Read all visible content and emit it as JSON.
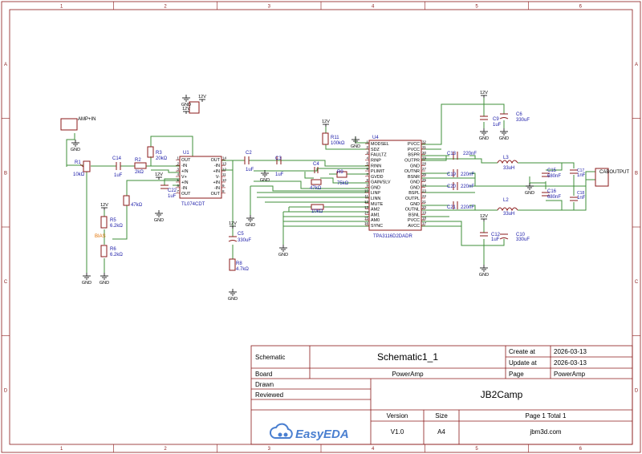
{
  "colors": {
    "frame": "#8b1a1a",
    "wire": "#3f8f3a",
    "part": "#8b1a1a",
    "label": "#1a1aa8",
    "pin": "#000000",
    "bias": "#e07000",
    "logo": "#4a7fd0"
  },
  "frame": {
    "columns": [
      "1",
      "2",
      "3",
      "4",
      "5",
      "6"
    ],
    "rows": [
      "A",
      "B",
      "C",
      "D"
    ]
  },
  "title_block": {
    "schematic_label": "Schematic",
    "schematic_value": "Schematic1_1",
    "create_label": "Create at",
    "create_value": "2026-03-13",
    "update_label": "Update at",
    "update_value": "2026-03-13",
    "board_label": "Board",
    "board_value": "PowerAmp",
    "page_label": "Page",
    "page_value": "PowerAmp",
    "drawn_label": "Drawn",
    "reviewed_label": "Reviewed",
    "company": "JB2Camp",
    "version_label": "Version",
    "version_value": "V1.0",
    "size_label": "Size",
    "size_value": "A4",
    "page_count": "Page  1  Total  1",
    "website": "jbm3d.com",
    "logo_text": "EasyEDA"
  },
  "labels": {
    "gnd": "GND",
    "v12": "12V",
    "amp_in": "AMP+IN",
    "bias": "BIAS",
    "cab_output": "CABOUTPUT",
    "r1": "R1",
    "r1_val": "10kΩ",
    "r2": "R2",
    "r2_val": "2kΩ",
    "r3": "R3",
    "r3_val": "20kΩ",
    "r4_val": "47kΩ",
    "r5": "R5",
    "r5_val": "6.2kΩ",
    "r6": "R6",
    "r6_val": "6.2kΩ",
    "r7_val": "47kΩ",
    "r8": "R8",
    "r8_val": "4.7kΩ",
    "r9": "R9",
    "r9_val": "75kΩ",
    "r10_val": "10kΩ",
    "r11": "R11",
    "r11_val": "100kΩ",
    "c1uf": "1uF",
    "c2": "C2",
    "c3": "C3",
    "c4": "C4",
    "c5": "C5",
    "c9": "C9",
    "c10": "C10",
    "c12": "C12",
    "c13": "C13",
    "c14": "C14",
    "c15": "C15",
    "c16": "C16",
    "c17": "C17",
    "c18": "C18",
    "c19": "C19",
    "c20": "C20",
    "c21": "C21",
    "c22": "C22",
    "c6": "C6",
    "c5_val": "330uF",
    "c6_val": "330uF",
    "c10_val": "330uF",
    "c15_val": "680nF",
    "c16_val": "680nF",
    "c220": "220nF",
    "c17_val": "1nF",
    "c18_val": "1nF",
    "l2": "L2",
    "l3": "L3",
    "l_val": "33uH",
    "u1": "U1",
    "u1_part": "TL074CDT",
    "u4": "U4",
    "u4_part": "TPA3116D2DADR"
  },
  "u1_pins_left": [
    {
      "num": "1",
      "name": "OUT"
    },
    {
      "num": "2",
      "name": "-IN"
    },
    {
      "num": "3",
      "name": "+IN"
    },
    {
      "num": "4",
      "name": "V+"
    },
    {
      "num": "5",
      "name": "+IN"
    },
    {
      "num": "6",
      "name": "-IN"
    },
    {
      "num": "7",
      "name": "OUT"
    }
  ],
  "u1_pins_right": [
    {
      "num": "14",
      "name": "OUT"
    },
    {
      "num": "13",
      "name": "-IN"
    },
    {
      "num": "12",
      "name": "+IN"
    },
    {
      "num": "11",
      "name": "V-"
    },
    {
      "num": "10",
      "name": "+IN"
    },
    {
      "num": "9",
      "name": "-IN"
    },
    {
      "num": "8",
      "name": "OUT"
    }
  ],
  "u4_pins_left": [
    {
      "num": "1",
      "name": "MODSEL"
    },
    {
      "num": "2",
      "name": "SDZ"
    },
    {
      "num": "3",
      "name": "FAULTZ"
    },
    {
      "num": "4",
      "name": "RINP"
    },
    {
      "num": "5",
      "name": "RINN"
    },
    {
      "num": "6",
      "name": "PLIMIT"
    },
    {
      "num": "7",
      "name": "GVDD"
    },
    {
      "num": "8",
      "name": "GAIN/SLV"
    },
    {
      "num": "9",
      "name": "GND"
    },
    {
      "num": "10",
      "name": "LINP"
    },
    {
      "num": "11",
      "name": "LINN"
    },
    {
      "num": "12",
      "name": "MUTE"
    },
    {
      "num": "13",
      "name": "AM2"
    },
    {
      "num": "14",
      "name": "AM1"
    },
    {
      "num": "15",
      "name": "AM0"
    },
    {
      "num": "16",
      "name": "SYNC"
    }
  ],
  "u4_pins_right": [
    {
      "num": "32",
      "name": "PVCC"
    },
    {
      "num": "31",
      "name": "PVCC"
    },
    {
      "num": "30",
      "name": "BSPR"
    },
    {
      "num": "29",
      "name": "OUTPR"
    },
    {
      "num": "28",
      "name": "GND"
    },
    {
      "num": "27",
      "name": "OUTNR"
    },
    {
      "num": "26",
      "name": "BSNR"
    },
    {
      "num": "25",
      "name": "GND"
    },
    {
      "num": "24",
      "name": "GND"
    },
    {
      "num": "23",
      "name": "BSPL"
    },
    {
      "num": "22",
      "name": "OUTPL"
    },
    {
      "num": "21",
      "name": "GND"
    },
    {
      "num": "20",
      "name": "OUTNL"
    },
    {
      "num": "19",
      "name": "BSNL"
    },
    {
      "num": "18",
      "name": "PVCC"
    },
    {
      "num": "17",
      "name": "AVCC"
    }
  ]
}
